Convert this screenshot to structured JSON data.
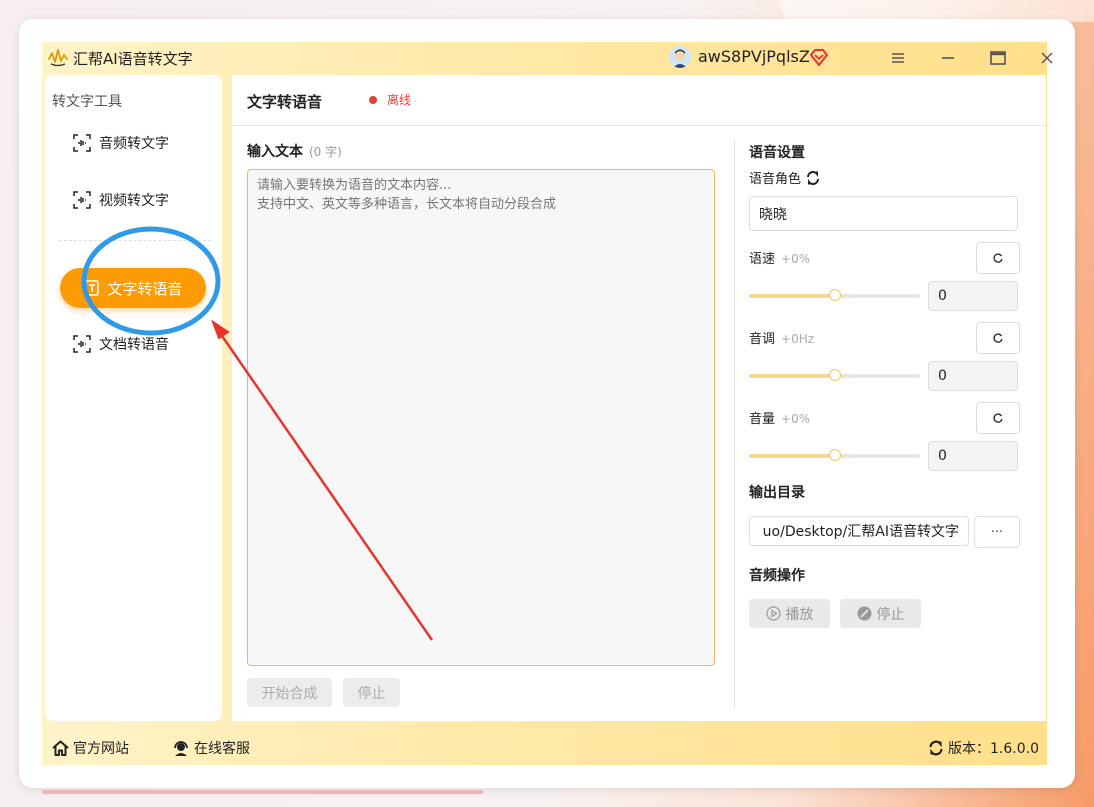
{
  "app": {
    "title": "汇帮AI语音转文字",
    "user_name": "awS8PVjPqlsZ"
  },
  "sidebar": {
    "heading": "转文字工具",
    "items": [
      {
        "label": "音频转文字"
      },
      {
        "label": "视频转文字"
      },
      {
        "label": "文字转语音",
        "active": true
      },
      {
        "label": "文档转语音"
      }
    ]
  },
  "main": {
    "title": "文字转语音",
    "status": "离线",
    "status_color": "#e94035"
  },
  "input": {
    "label": "输入文本",
    "count": "(0 字)",
    "placeholder": "请输入要转换为语音的文本内容...\n支持中文、英文等多种语言，长文本将自动分段合成",
    "start_button": "开始合成",
    "stop_button": "停止"
  },
  "settings": {
    "title": "语音设置",
    "role_label": "语音角色",
    "role_value": "晓晓",
    "speed": {
      "label": "语速",
      "hint": "+0%",
      "value": "0",
      "slider_fraction": 0.5
    },
    "pitch": {
      "label": "音调",
      "hint": "+0Hz",
      "value": "0",
      "slider_fraction": 0.5
    },
    "volume": {
      "label": "音量",
      "hint": "+0%",
      "value": "0",
      "slider_fraction": 0.5
    },
    "output_title": "输出目录",
    "output_path": "uo/Desktop/汇帮AI语音转文字",
    "browse_button": "···",
    "audio_title": "音频操作",
    "play_button": "播放",
    "stop_button": "停止"
  },
  "footer": {
    "website": "官方网站",
    "support": "在线客服",
    "version": "版本：1.6.0.0"
  },
  "colors": {
    "accent": "#fd9b05",
    "annotation_circle": "#2f9ae8",
    "annotation_arrow": "#e8332c"
  }
}
